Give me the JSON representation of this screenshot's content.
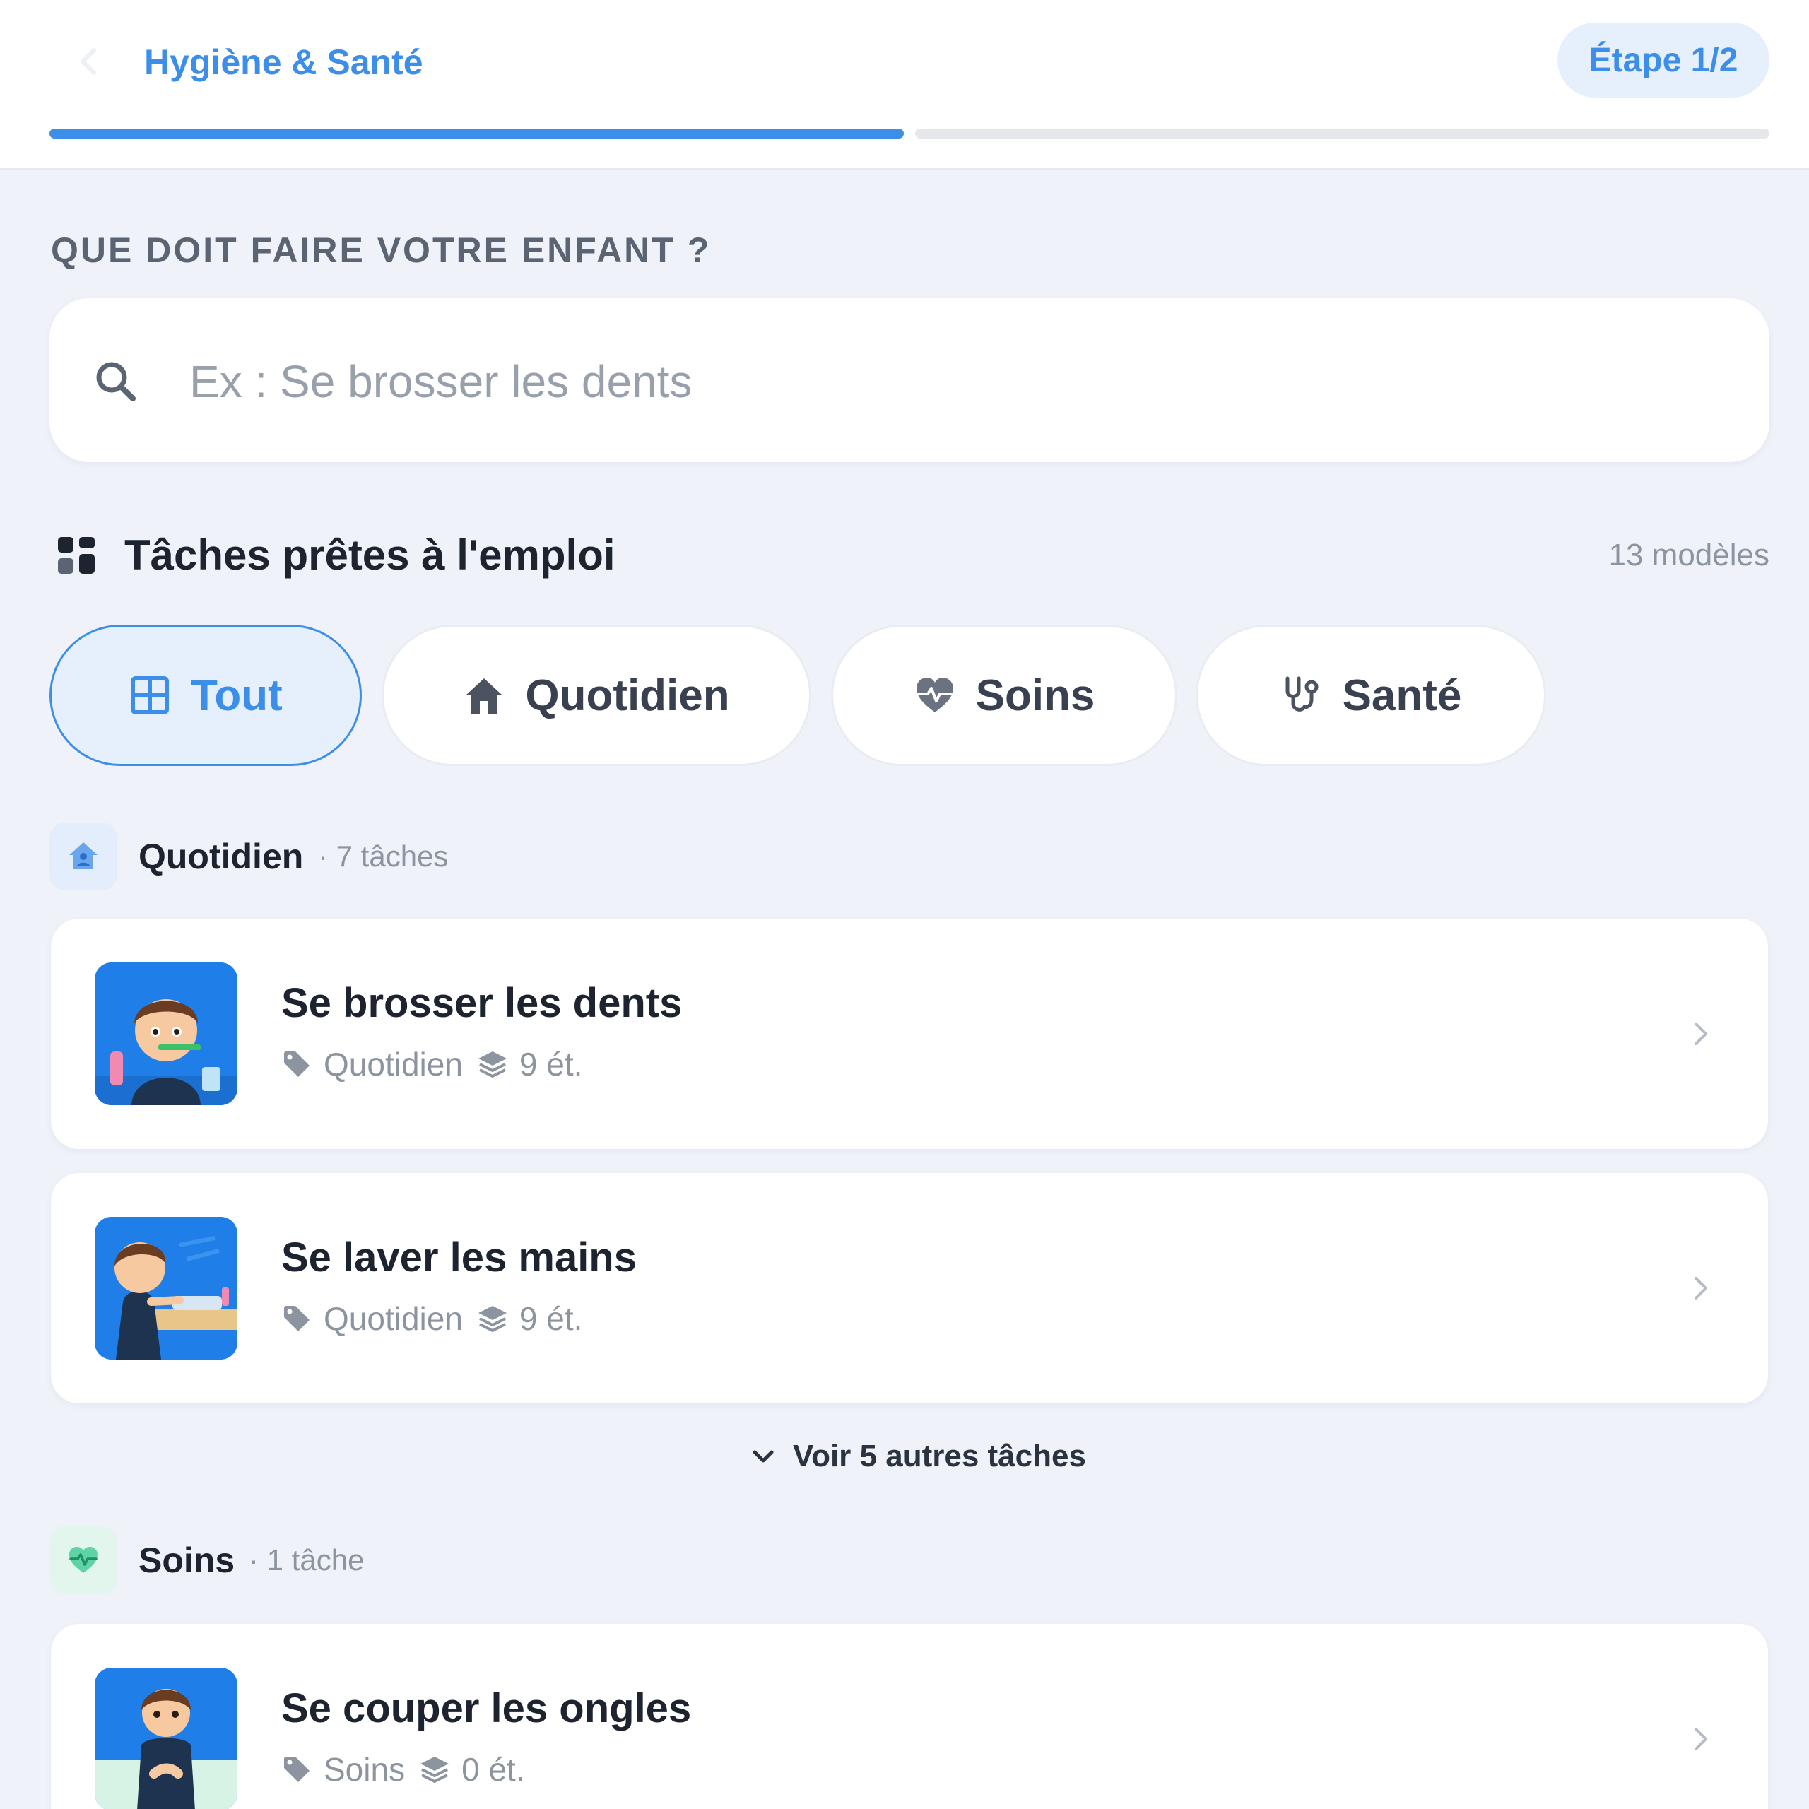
{
  "header": {
    "title": "Hygiène & Santé",
    "step": "Étape 1/2",
    "progress": {
      "current": 1,
      "total": 2
    }
  },
  "prompt": {
    "label": "QUE DOIT FAIRE VOTRE ENFANT ?"
  },
  "search": {
    "placeholder": "Ex : Se brosser les dents",
    "value": "",
    "icon": "search-icon"
  },
  "templates": {
    "title": "Tâches prêtes à l'emploi",
    "count": "13 modèles",
    "icon": "grid-icon"
  },
  "filters": [
    {
      "label": "Tout",
      "icon": "grid-icon",
      "active": true
    },
    {
      "label": "Quotidien",
      "icon": "home-icon",
      "active": false
    },
    {
      "label": "Soins",
      "icon": "heart-pulse-icon",
      "active": false
    },
    {
      "label": "Santé",
      "icon": "stethoscope-icon",
      "active": false
    }
  ],
  "groups": [
    {
      "name": "Quotidien",
      "count": "· 7 tâches",
      "icon": "home-person-icon",
      "accent": "#3c8ee8",
      "tasks": [
        {
          "title": "Se brosser les dents",
          "category": "Quotidien",
          "steps": "9 ét."
        },
        {
          "title": "Se laver les mains",
          "category": "Quotidien",
          "steps": "9 ét."
        }
      ],
      "more": "Voir 5 autres tâches"
    },
    {
      "name": "Soins",
      "count": "· 1 tâche",
      "icon": "heart-pulse-icon",
      "accent": "#22b07d",
      "tasks": [
        {
          "title": "Se couper les ongles",
          "category": "Soins",
          "steps": "0 ét."
        }
      ]
    }
  ],
  "colors": {
    "accent": "#3c8ee8",
    "background": "#eff2f9",
    "card": "#ffffff",
    "muted": "#8c94a0"
  }
}
